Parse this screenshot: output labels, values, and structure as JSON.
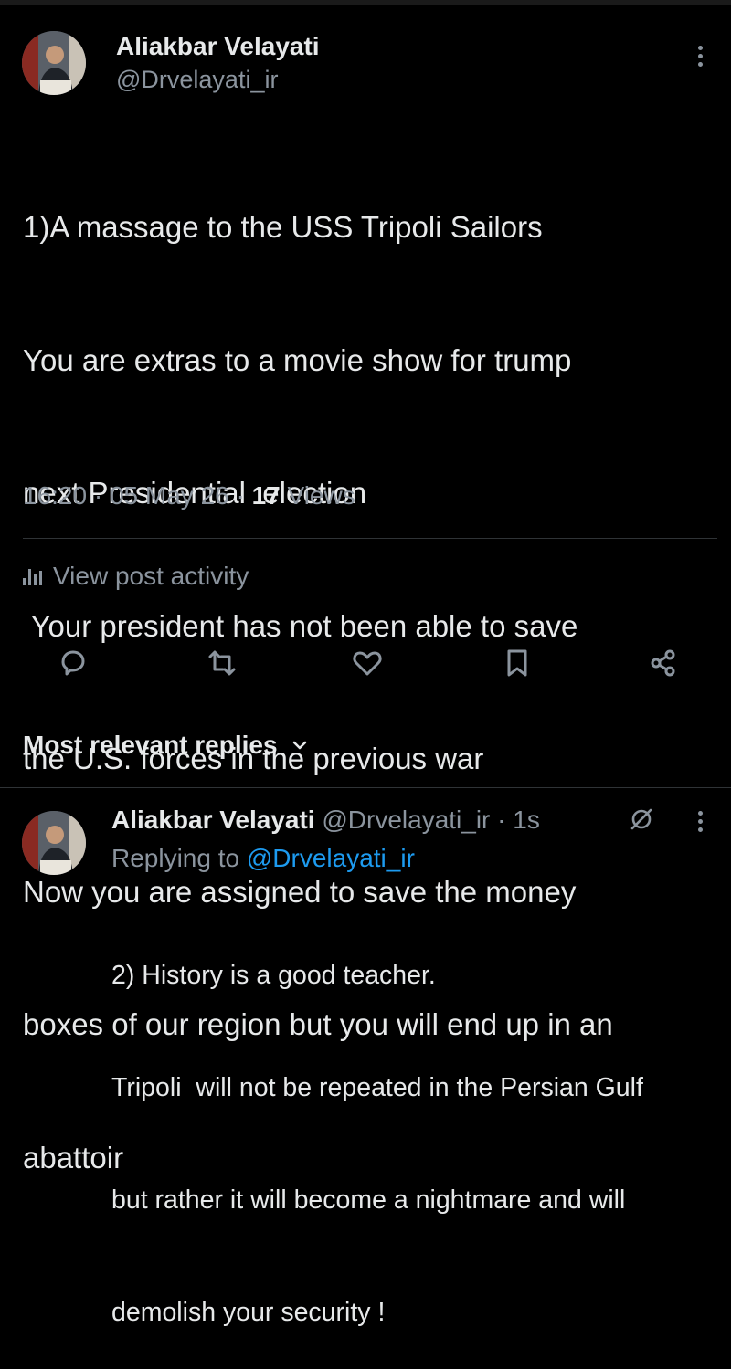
{
  "post": {
    "author_name": "Aliakbar Velayati",
    "author_handle": "@Drvelayati_ir",
    "lines": [
      "1)A massage to the USS Tripoli Sailors",
      "You are extras to a movie show for trump",
      "next Presidential  election",
      " Your president has not been able to save",
      "the U.S. forces in the previous war",
      "Now you are assigned to save the money",
      "boxes of our region but you will end up in an",
      "abattoir"
    ],
    "time": "16:20",
    "separator": " · ",
    "date": "05 May 26",
    "views_count": "17",
    "views_label": " Views"
  },
  "activity": {
    "label": "View post activity"
  },
  "actions": {
    "icons": [
      "reply-icon",
      "repost-icon",
      "like-icon",
      "bookmark-icon",
      "share-icon"
    ]
  },
  "replies_sort": {
    "label": "Most relevant replies"
  },
  "reply": {
    "author_name": "Aliakbar Velayati",
    "meta": " @Drvelayati_ir · 1s",
    "replying_prefix": "Replying to ",
    "replying_handle": "@Drvelayati_ir",
    "lines": [
      "2) History is a good teacher.",
      "Tripoli  will not be repeated in the Persian Gulf",
      "but rather it will become a nightmare and will",
      "demolish your security !"
    ]
  },
  "colors": {
    "background": "#000000",
    "text": "#e7e9ea",
    "muted": "#8b949e",
    "link": "#1d9bf0",
    "divider": "#2f3336"
  }
}
